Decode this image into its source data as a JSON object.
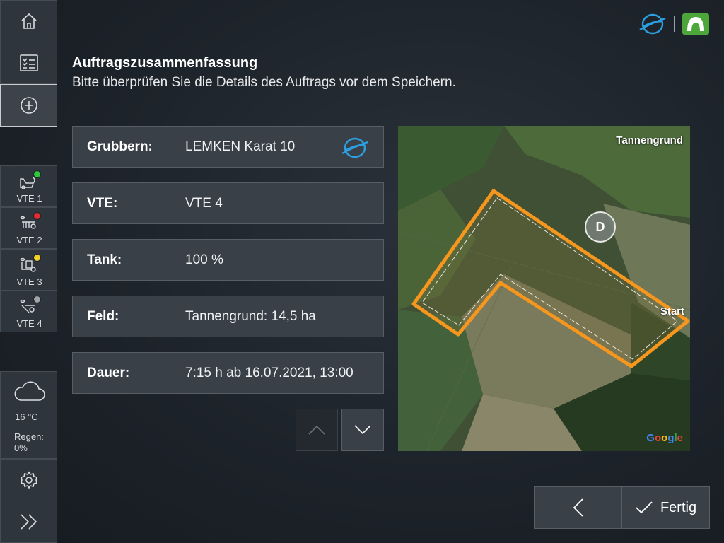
{
  "header": {
    "title": "Auftragszusammenfassung",
    "subtitle": "Bitte überprüfen Sie die Details des Auftrags vor dem Speichern."
  },
  "details": [
    {
      "label": "Grubbern:",
      "value": "LEMKEN Karat 10",
      "icon": "lemken-logo-icon"
    },
    {
      "label": "VTE:",
      "value": "VTE 4"
    },
    {
      "label": "Tank:",
      "value": "100 %"
    },
    {
      "label": "Feld:",
      "value": "Tannengrund: 14,5 ha"
    },
    {
      "label": "Dauer:",
      "value": "7:15 h ab 16.07.2021, 13:00"
    }
  ],
  "sidebar": {
    "nav": [
      {
        "icon": "home-icon"
      },
      {
        "icon": "checklist-icon"
      },
      {
        "icon": "add-circle-icon",
        "active": true
      }
    ],
    "vtes": [
      {
        "label": "VTE 1",
        "status_color": "#2ec93a"
      },
      {
        "label": "VTE 2",
        "status_color": "#e52b2b"
      },
      {
        "label": "VTE 3",
        "status_color": "#f2d22a"
      },
      {
        "label": "VTE 4",
        "status_color": "#a0a4a8"
      }
    ],
    "weather": {
      "icon": "cloud-icon",
      "temperature": "16 °C",
      "rain": "Regen: 0%"
    },
    "settings_icon": "gear-icon",
    "expand_icon": "double-chevron-right-icon"
  },
  "map": {
    "field_name": "Tannengrund",
    "start_label": "Start",
    "marker_label": "D",
    "attribution": "Google"
  },
  "footer": {
    "back_icon": "chevron-left-icon",
    "done_label": "Fertig",
    "done_icon": "check-icon"
  },
  "colors": {
    "accent_orange": "#f5961e",
    "lemken_blue": "#2d9fe0",
    "krone_green": "#4da63a"
  }
}
